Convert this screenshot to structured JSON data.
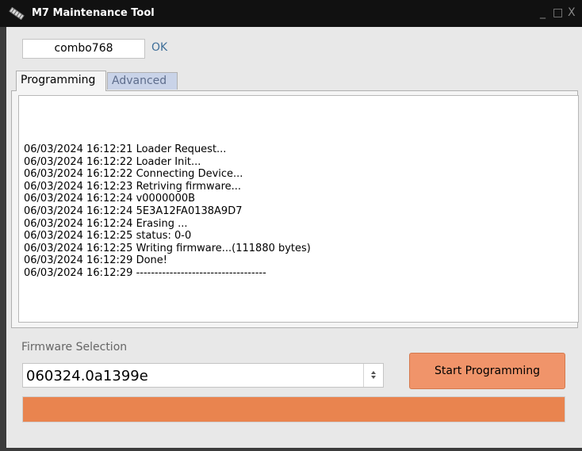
{
  "window": {
    "title": "M7 Maintenance Tool",
    "controls": {
      "minimize": "_",
      "maximize": "□",
      "close": "X"
    }
  },
  "device": {
    "id_value": "combo768",
    "status": "OK"
  },
  "tabs": [
    {
      "label": "Programming",
      "active": true
    },
    {
      "label": "Advanced",
      "active": false
    }
  ],
  "log": {
    "lines": [
      "06/03/2024 16:12:21 Loader Request...",
      "06/03/2024 16:12:22 Loader Init...",
      "06/03/2024 16:12:22 Connecting Device...",
      "06/03/2024 16:12:23 Retriving firmware...",
      "06/03/2024 16:12:24 v0000000B",
      "06/03/2024 16:12:24 5E3A12FA0138A9D7",
      "06/03/2024 16:12:24 Erasing ...",
      "06/03/2024 16:12:25 status: 0-0",
      "06/03/2024 16:12:25 Writing firmware...(111880 bytes)",
      "06/03/2024 16:12:29 Done!",
      "06/03/2024 16:12:29 -----------------------------------"
    ]
  },
  "firmware": {
    "label": "Firmware Selection",
    "selected": "060324.0a1399e",
    "spinner_icon": "updown-icon"
  },
  "actions": {
    "start_label": "Start Programming"
  },
  "progress": {
    "fraction": 1.0
  },
  "colors": {
    "accent": "#e9844f",
    "button": "#f0946a",
    "titlebar": "#111111",
    "inactive_tab": "#c9d3e8",
    "status_text": "#3f6f99"
  }
}
